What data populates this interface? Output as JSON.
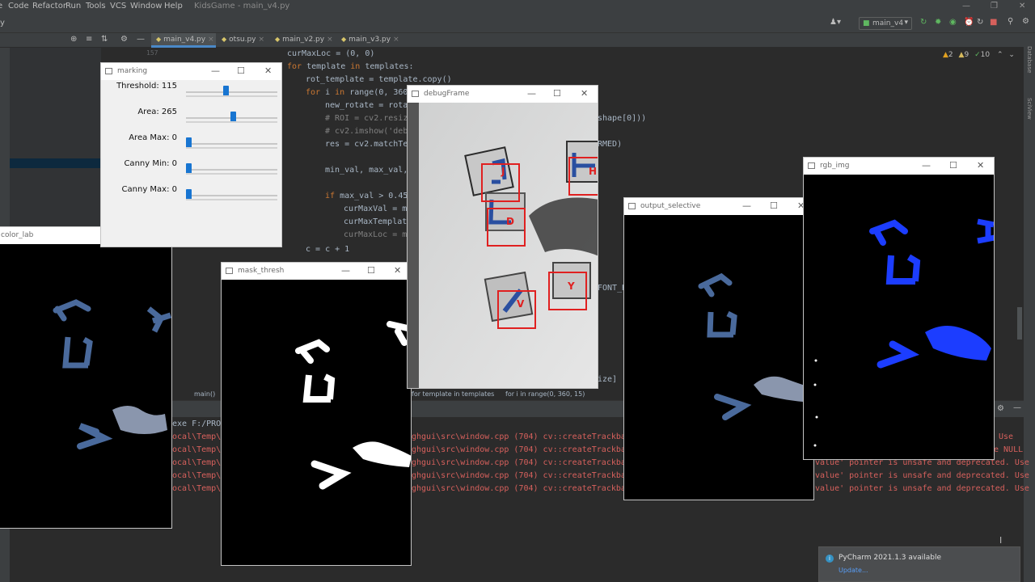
{
  "menu": {
    "items": [
      "Code",
      "Refactor",
      "Run",
      "Tools",
      "VCS",
      "Window",
      "Help"
    ],
    "window_title": "KidsGame - main_v4.py"
  },
  "toolbar": {
    "run_config": "main_v4"
  },
  "tabs": [
    {
      "label": "main_v4.py",
      "active": true
    },
    {
      "label": "otsu.py",
      "active": false
    },
    {
      "label": "main_v2.py",
      "active": false
    },
    {
      "label": "main_v3.py",
      "active": false
    }
  ],
  "inspection": {
    "warnings": "2",
    "weak_warnings": "9",
    "ok": "10"
  },
  "right_tools": [
    "Database",
    "SciView"
  ],
  "editor": {
    "line_number": "157",
    "lines": {
      "l1": "curMaxLoc = (0, 0)",
      "l2_kw": "for",
      "l2_rest": " template ",
      "l2_kw2": "in",
      "l2_rest2": " templates:",
      "l3": "rot_template = template.copy()",
      "l4_kw": "for",
      "l4_rest": " i ",
      "l4_kw2": "in",
      "l4_rest2": " range(0, 360",
      "l5": "new_rotate = rota",
      "l6": "# ROI = cv2.resiz",
      "l6b": "shape[0]))",
      "l7": "# cv2.imshow('deb",
      "l8": "res = cv2.matchTem",
      "l8b": "RMED)",
      "l9": "min_val, max_val,",
      "l10_kw": "if",
      "l10_rest": " max_val > 0.45",
      "l11": "curMaxVal = ma",
      "l12": "curMaxTemplat",
      "l13": "curMaxLoc = m",
      "l14": "c = c + 1",
      "l15b": "FONT_H",
      "l16b": "ize]"
    }
  },
  "breadcrumb": {
    "fn": "main()",
    "b1": "for template in templates",
    "b2": "for i in range(0, 360, 15)"
  },
  "run_console": {
    "exe_line": "exe F:/PROJ",
    "left_prefix": "ocal\\Temp\\p",
    "mid_text": "ghgui\\src\\window.cpp (704) cv::createTrackbar",
    "right_texts": [
      " Use",
      "e NULL",
      "value' pointer is unsafe and deprecated. Use",
      "value' pointer is unsafe and deprecated. Use",
      "value' pointer is unsafe and deprecated. Use"
    ]
  },
  "notification": {
    "title": "PyCharm 2021.1.3 available",
    "link": "Update..."
  },
  "cv_windows": {
    "marking": "marking",
    "color_lab": "color_lab",
    "mask_thresh": "mask_thresh",
    "debugFrame": "debugFrame",
    "output_selective": "output_selective",
    "rgb_img": "rgb_img"
  },
  "trackbars": [
    {
      "label": "Threshold: 115",
      "level": 0.43
    },
    {
      "label": "Area: 265",
      "level": 0.52
    },
    {
      "label": "Area Max: 0",
      "level": 0.0
    },
    {
      "label": "Canny Min: 0",
      "level": 0.0
    },
    {
      "label": "Canny Max: 0",
      "level": 0.0
    }
  ],
  "debug_labels": [
    "J",
    "D",
    "H",
    "Y",
    "V"
  ],
  "colors": {
    "accent": "#4a88c7",
    "error": "#d6605c",
    "blob_blue": "#1c3dff",
    "dbg_red": "#e02020"
  }
}
